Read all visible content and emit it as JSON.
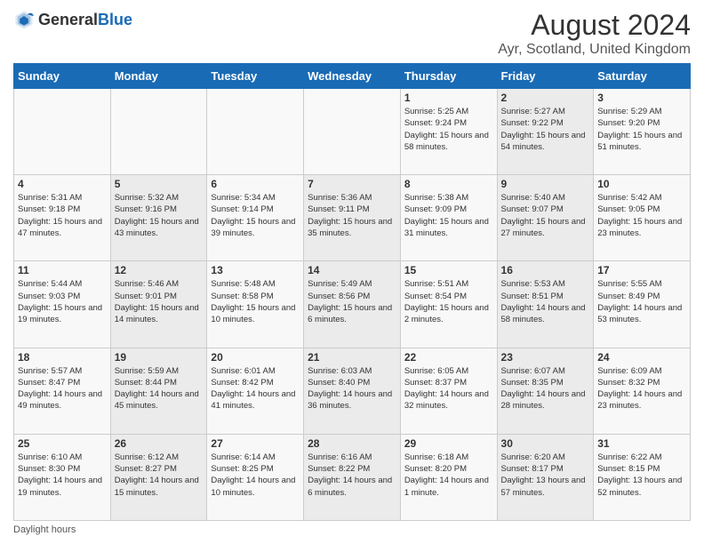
{
  "header": {
    "logo_general": "General",
    "logo_blue": "Blue",
    "title": "August 2024",
    "location": "Ayr, Scotland, United Kingdom"
  },
  "calendar": {
    "days_of_week": [
      "Sunday",
      "Monday",
      "Tuesday",
      "Wednesday",
      "Thursday",
      "Friday",
      "Saturday"
    ],
    "weeks": [
      [
        {
          "day": "",
          "info": ""
        },
        {
          "day": "",
          "info": ""
        },
        {
          "day": "",
          "info": ""
        },
        {
          "day": "",
          "info": ""
        },
        {
          "day": "1",
          "info": "Sunrise: 5:25 AM\nSunset: 9:24 PM\nDaylight: 15 hours\nand 58 minutes."
        },
        {
          "day": "2",
          "info": "Sunrise: 5:27 AM\nSunset: 9:22 PM\nDaylight: 15 hours\nand 54 minutes."
        },
        {
          "day": "3",
          "info": "Sunrise: 5:29 AM\nSunset: 9:20 PM\nDaylight: 15 hours\nand 51 minutes."
        }
      ],
      [
        {
          "day": "4",
          "info": "Sunrise: 5:31 AM\nSunset: 9:18 PM\nDaylight: 15 hours\nand 47 minutes."
        },
        {
          "day": "5",
          "info": "Sunrise: 5:32 AM\nSunset: 9:16 PM\nDaylight: 15 hours\nand 43 minutes."
        },
        {
          "day": "6",
          "info": "Sunrise: 5:34 AM\nSunset: 9:14 PM\nDaylight: 15 hours\nand 39 minutes."
        },
        {
          "day": "7",
          "info": "Sunrise: 5:36 AM\nSunset: 9:11 PM\nDaylight: 15 hours\nand 35 minutes."
        },
        {
          "day": "8",
          "info": "Sunrise: 5:38 AM\nSunset: 9:09 PM\nDaylight: 15 hours\nand 31 minutes."
        },
        {
          "day": "9",
          "info": "Sunrise: 5:40 AM\nSunset: 9:07 PM\nDaylight: 15 hours\nand 27 minutes."
        },
        {
          "day": "10",
          "info": "Sunrise: 5:42 AM\nSunset: 9:05 PM\nDaylight: 15 hours\nand 23 minutes."
        }
      ],
      [
        {
          "day": "11",
          "info": "Sunrise: 5:44 AM\nSunset: 9:03 PM\nDaylight: 15 hours\nand 19 minutes."
        },
        {
          "day": "12",
          "info": "Sunrise: 5:46 AM\nSunset: 9:01 PM\nDaylight: 15 hours\nand 14 minutes."
        },
        {
          "day": "13",
          "info": "Sunrise: 5:48 AM\nSunset: 8:58 PM\nDaylight: 15 hours\nand 10 minutes."
        },
        {
          "day": "14",
          "info": "Sunrise: 5:49 AM\nSunset: 8:56 PM\nDaylight: 15 hours\nand 6 minutes."
        },
        {
          "day": "15",
          "info": "Sunrise: 5:51 AM\nSunset: 8:54 PM\nDaylight: 15 hours\nand 2 minutes."
        },
        {
          "day": "16",
          "info": "Sunrise: 5:53 AM\nSunset: 8:51 PM\nDaylight: 14 hours\nand 58 minutes."
        },
        {
          "day": "17",
          "info": "Sunrise: 5:55 AM\nSunset: 8:49 PM\nDaylight: 14 hours\nand 53 minutes."
        }
      ],
      [
        {
          "day": "18",
          "info": "Sunrise: 5:57 AM\nSunset: 8:47 PM\nDaylight: 14 hours\nand 49 minutes."
        },
        {
          "day": "19",
          "info": "Sunrise: 5:59 AM\nSunset: 8:44 PM\nDaylight: 14 hours\nand 45 minutes."
        },
        {
          "day": "20",
          "info": "Sunrise: 6:01 AM\nSunset: 8:42 PM\nDaylight: 14 hours\nand 41 minutes."
        },
        {
          "day": "21",
          "info": "Sunrise: 6:03 AM\nSunset: 8:40 PM\nDaylight: 14 hours\nand 36 minutes."
        },
        {
          "day": "22",
          "info": "Sunrise: 6:05 AM\nSunset: 8:37 PM\nDaylight: 14 hours\nand 32 minutes."
        },
        {
          "day": "23",
          "info": "Sunrise: 6:07 AM\nSunset: 8:35 PM\nDaylight: 14 hours\nand 28 minutes."
        },
        {
          "day": "24",
          "info": "Sunrise: 6:09 AM\nSunset: 8:32 PM\nDaylight: 14 hours\nand 23 minutes."
        }
      ],
      [
        {
          "day": "25",
          "info": "Sunrise: 6:10 AM\nSunset: 8:30 PM\nDaylight: 14 hours\nand 19 minutes."
        },
        {
          "day": "26",
          "info": "Sunrise: 6:12 AM\nSunset: 8:27 PM\nDaylight: 14 hours\nand 15 minutes."
        },
        {
          "day": "27",
          "info": "Sunrise: 6:14 AM\nSunset: 8:25 PM\nDaylight: 14 hours\nand 10 minutes."
        },
        {
          "day": "28",
          "info": "Sunrise: 6:16 AM\nSunset: 8:22 PM\nDaylight: 14 hours\nand 6 minutes."
        },
        {
          "day": "29",
          "info": "Sunrise: 6:18 AM\nSunset: 8:20 PM\nDaylight: 14 hours\nand 1 minute."
        },
        {
          "day": "30",
          "info": "Sunrise: 6:20 AM\nSunset: 8:17 PM\nDaylight: 13 hours\nand 57 minutes."
        },
        {
          "day": "31",
          "info": "Sunrise: 6:22 AM\nSunset: 8:15 PM\nDaylight: 13 hours\nand 52 minutes."
        }
      ]
    ]
  },
  "footer": {
    "daylight_hours": "Daylight hours"
  }
}
